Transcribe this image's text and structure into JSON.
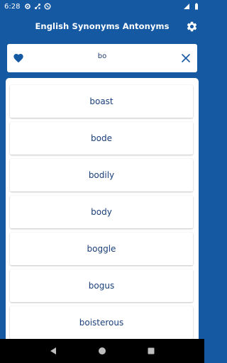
{
  "status_bar": {
    "time": "6:28"
  },
  "app_bar": {
    "title": "English Synonyms Antonyms"
  },
  "search": {
    "value": "bo"
  },
  "words": [
    "boast",
    "bode",
    "bodily",
    "body",
    "boggle",
    "bogus",
    "boisterous"
  ],
  "colors": {
    "primary": "#1559a3",
    "text": "#1a3f7a",
    "nav": "#000000"
  },
  "icons": [
    "gear-icon",
    "heart-icon",
    "close-icon",
    "back-icon",
    "home-icon",
    "recents-icon"
  ]
}
